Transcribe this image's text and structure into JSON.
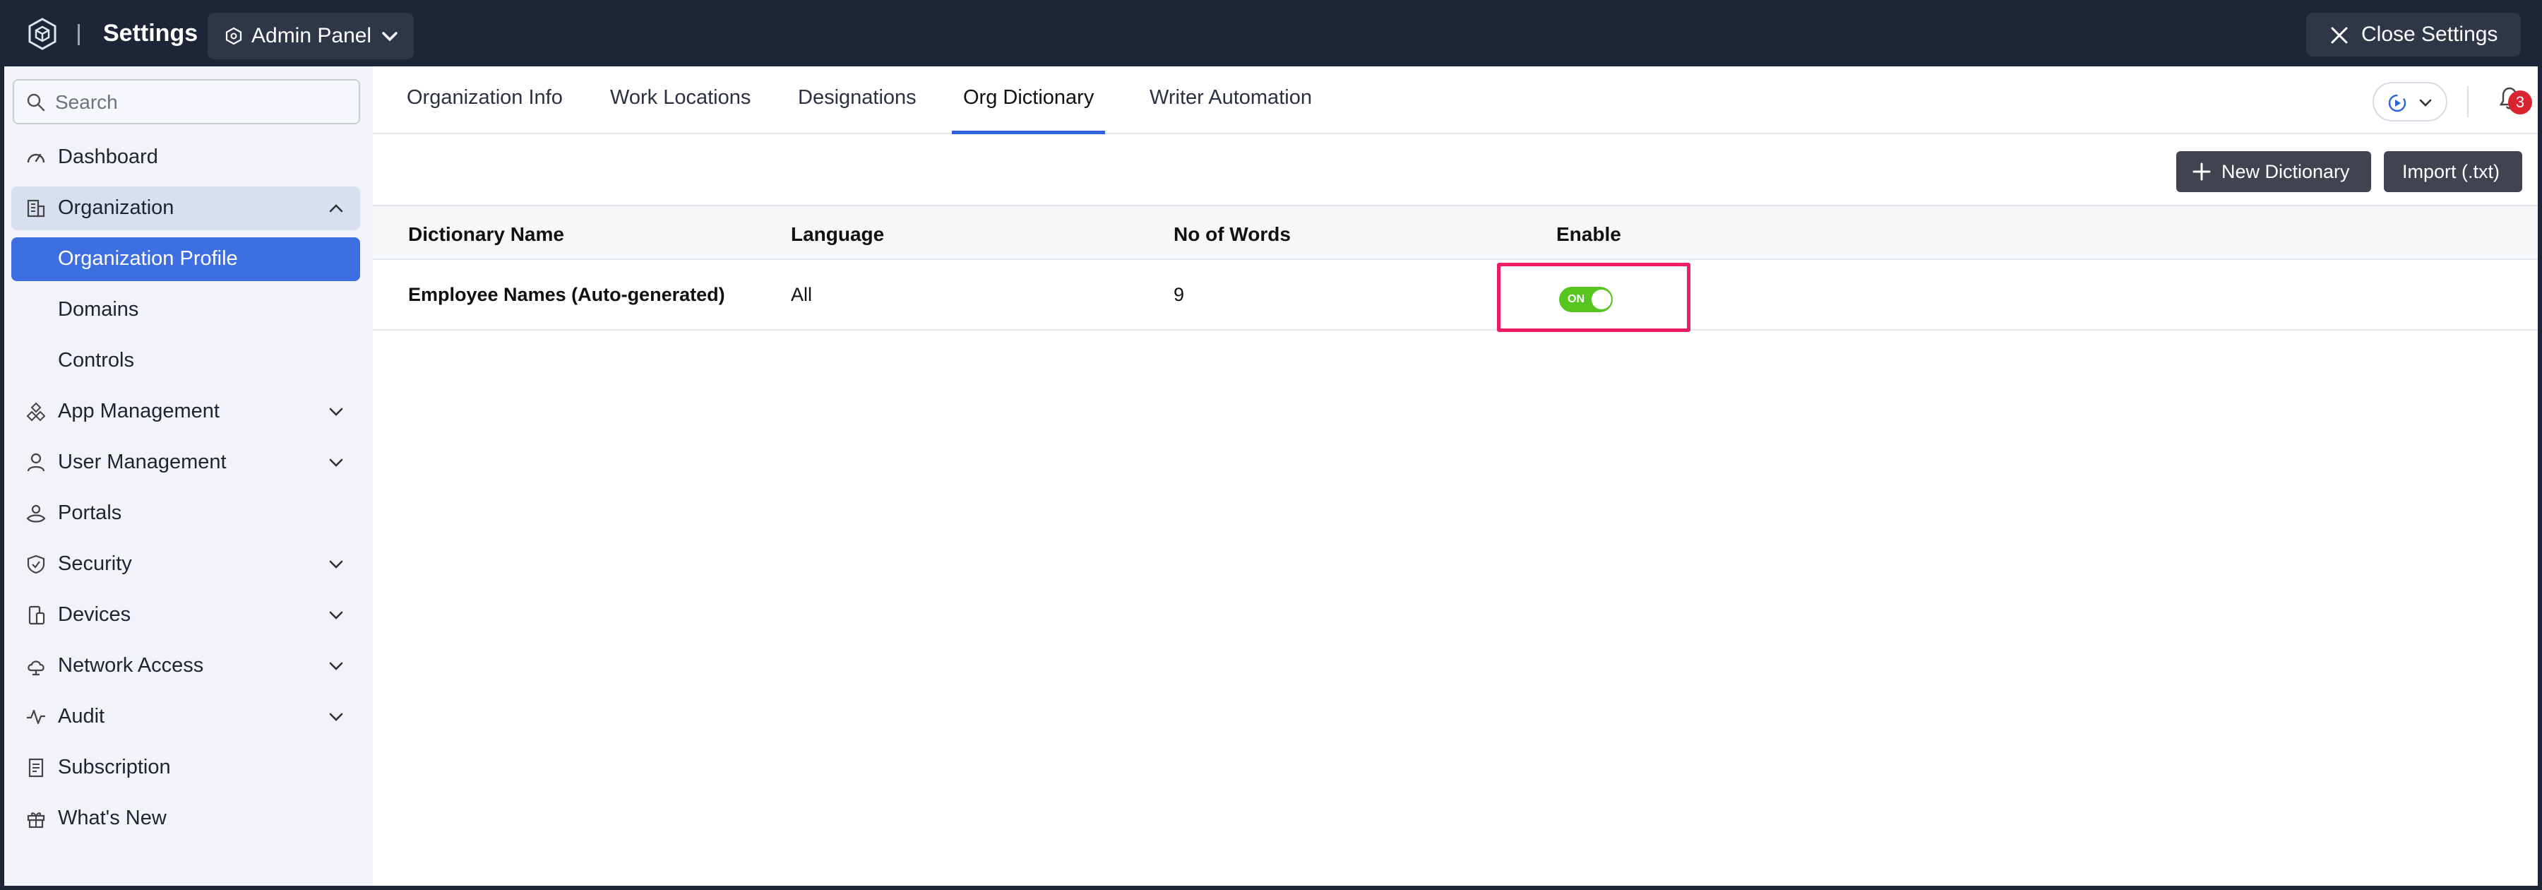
{
  "topbar": {
    "title": "Settings",
    "admin_panel_label": "Admin Panel",
    "close_label": "Close Settings"
  },
  "sidebar": {
    "search_placeholder": "Search",
    "items": [
      {
        "label": "Dashboard",
        "icon": "gauge-icon"
      },
      {
        "label": "Organization",
        "icon": "building-icon",
        "expanded": true
      },
      {
        "label": "Organization Profile",
        "active": true,
        "sub": true
      },
      {
        "label": "Domains",
        "sub": true
      },
      {
        "label": "Controls",
        "sub": true
      },
      {
        "label": "App Management",
        "icon": "apps-icon"
      },
      {
        "label": "User Management",
        "icon": "user-icon"
      },
      {
        "label": "Portals",
        "icon": "portal-icon"
      },
      {
        "label": "Security",
        "icon": "shield-icon"
      },
      {
        "label": "Devices",
        "icon": "devices-icon"
      },
      {
        "label": "Network Access",
        "icon": "cloud-icon"
      },
      {
        "label": "Audit",
        "icon": "pulse-icon"
      },
      {
        "label": "Subscription",
        "icon": "receipt-icon"
      },
      {
        "label": "What's New",
        "icon": "gift-icon"
      }
    ]
  },
  "tabs": [
    {
      "label": "Organization Info"
    },
    {
      "label": "Work Locations"
    },
    {
      "label": "Designations"
    },
    {
      "label": "Org Dictionary",
      "active": true
    },
    {
      "label": "Writer Automation"
    }
  ],
  "notifications": {
    "count": "3"
  },
  "actions": {
    "new_dictionary": "New Dictionary",
    "import": "Import (.txt)"
  },
  "table": {
    "columns": [
      "Dictionary Name",
      "Language",
      "No of Words",
      "Enable"
    ],
    "rows": [
      {
        "name": "Employee Names (Auto-generated)",
        "language": "All",
        "words": "9",
        "enabled": true,
        "toggle_text": "ON"
      }
    ]
  },
  "colors": {
    "topbar": "#1e2538",
    "active_nav": "#3d6fe3",
    "toggle_on": "#57c51f",
    "highlight": "#ee1c64",
    "badge": "#d9232e"
  }
}
